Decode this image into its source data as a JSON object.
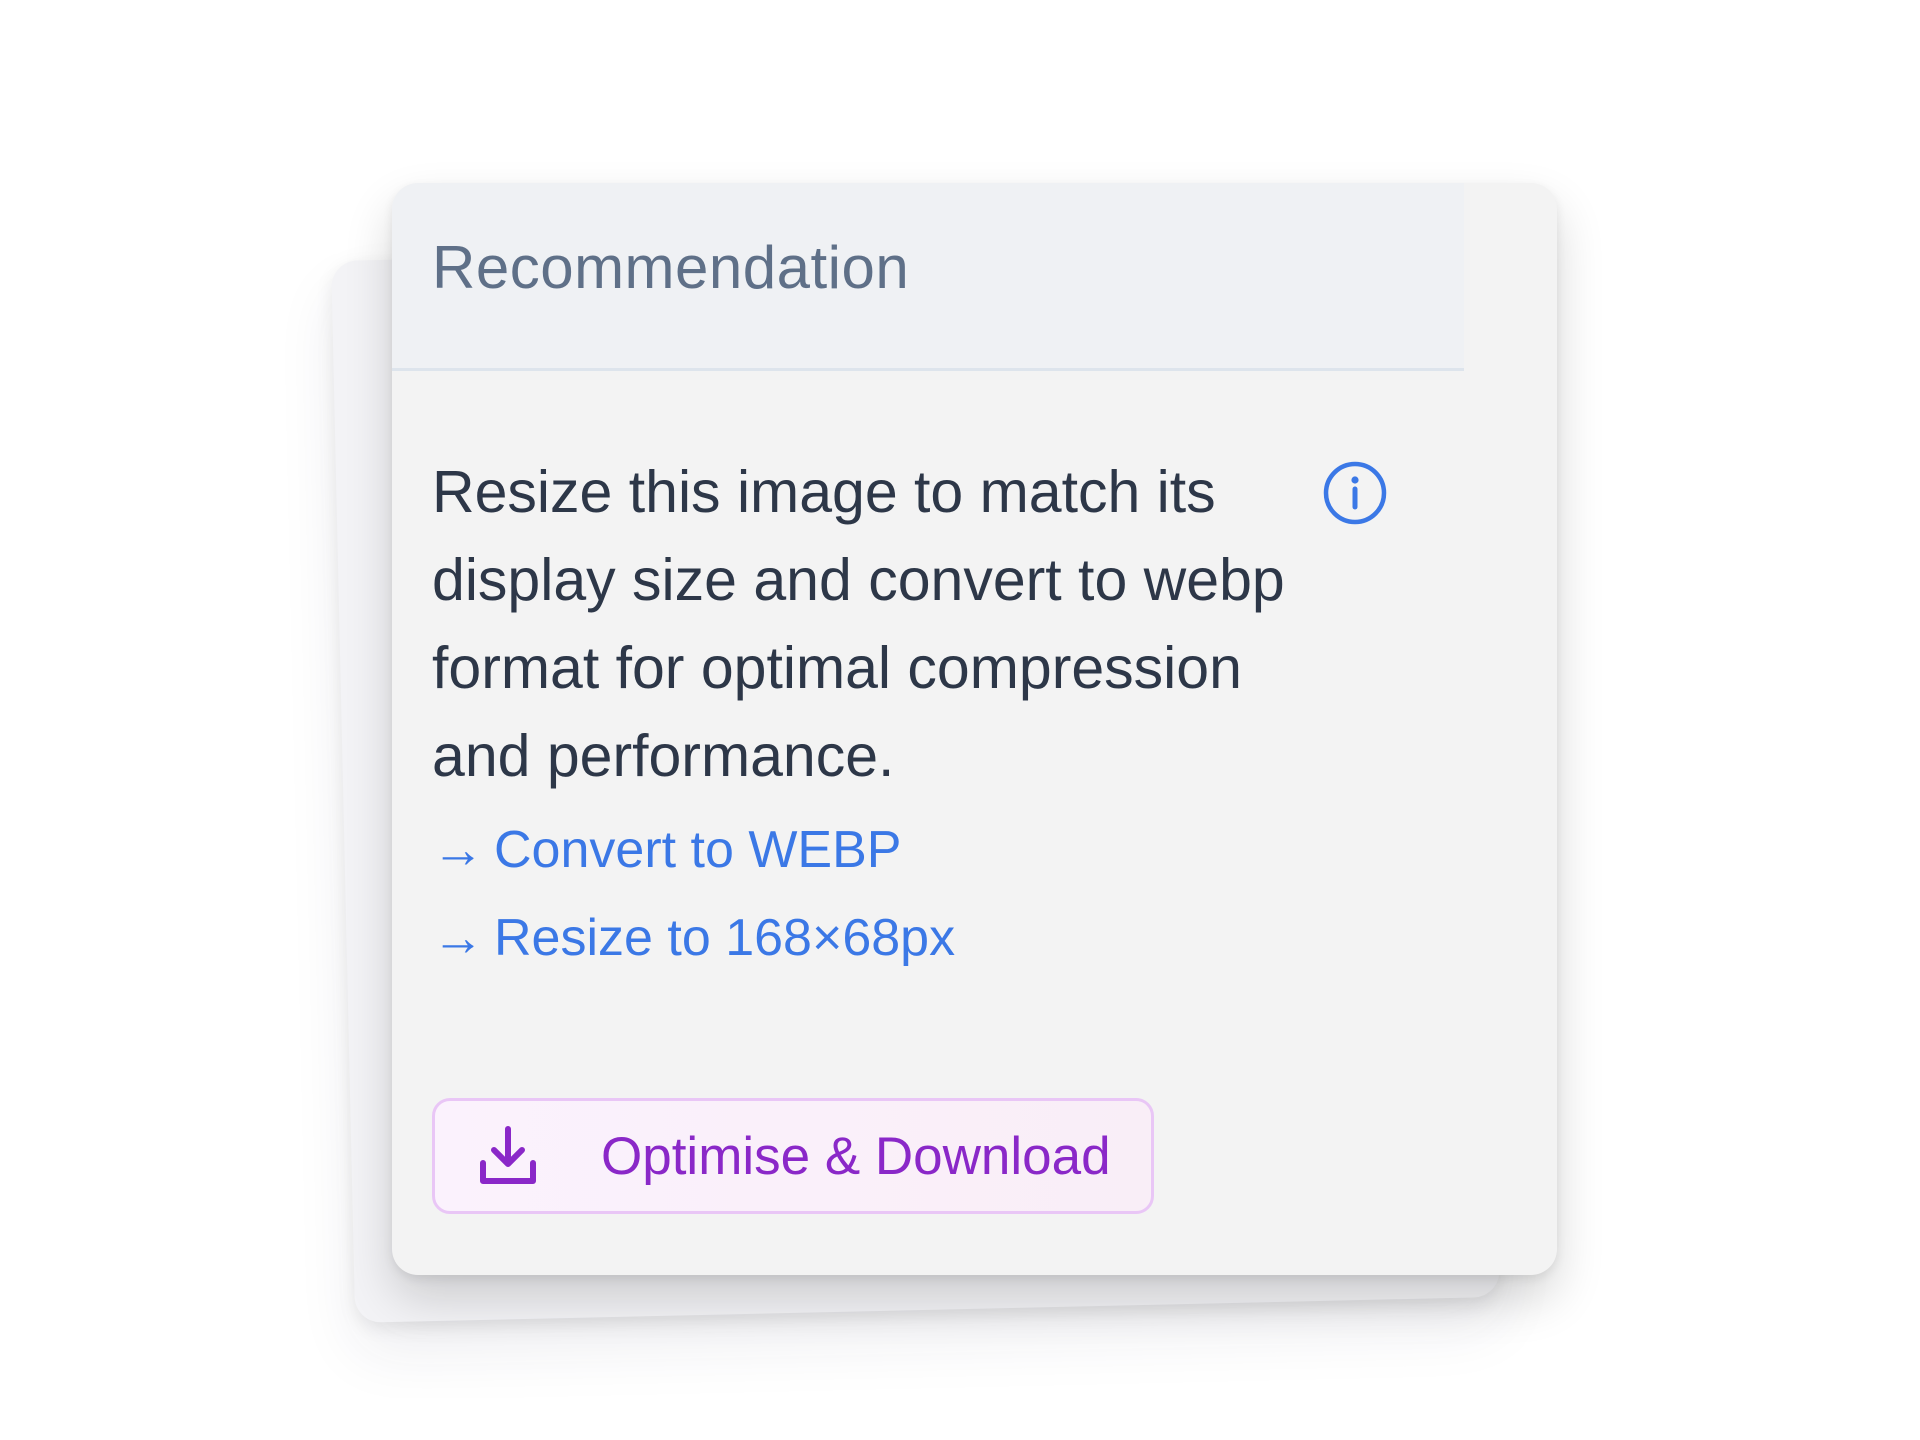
{
  "card": {
    "title": "Recommendation",
    "recommendation": "Resize this image to match its display size and convert to webp format for optimal compression and performance.",
    "actions": [
      {
        "arrow": "→",
        "label": "Convert to WEBP"
      },
      {
        "arrow": "→",
        "label": "Resize to 168×68px"
      }
    ],
    "download_button": {
      "label": "Optimise & Download",
      "icon": "download-icon"
    },
    "info_icon": "info-icon"
  },
  "colors": {
    "title": "#5f7088",
    "body_text": "#2d3748",
    "link": "#3b78e6",
    "button_text": "#8a28c8",
    "button_border": "#e9c6f6",
    "card_bg": "#f3f3f3",
    "header_bg": "#eff1f4"
  }
}
